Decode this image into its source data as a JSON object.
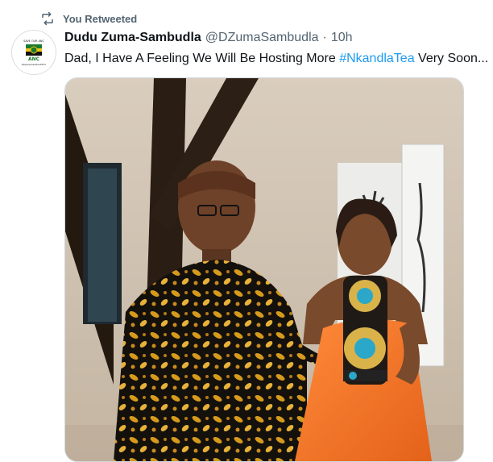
{
  "retweet": {
    "label": "You Retweeted",
    "icon": "retweet-icon"
  },
  "tweet": {
    "author": {
      "display_name": "Dudu Zuma-Sambudla",
      "handle": "@DZumaSambudla",
      "avatar_logo_text": [
        "SAVE OUR ANC",
        "ANC",
        "#KeepAwakeMoreEffort"
      ]
    },
    "separator": "·",
    "time": "10h",
    "text_before": "Dad, I Have A Feeling We Will Be Hosting More ",
    "hashtag": "#NkandlaTea",
    "text_after": " Very Soon...",
    "media_alt": "Photo"
  },
  "colors": {
    "hashtag": "#1d9bf0",
    "secondary_text": "#536471",
    "primary_text": "#0f1419",
    "dress": "#f27a2a"
  }
}
